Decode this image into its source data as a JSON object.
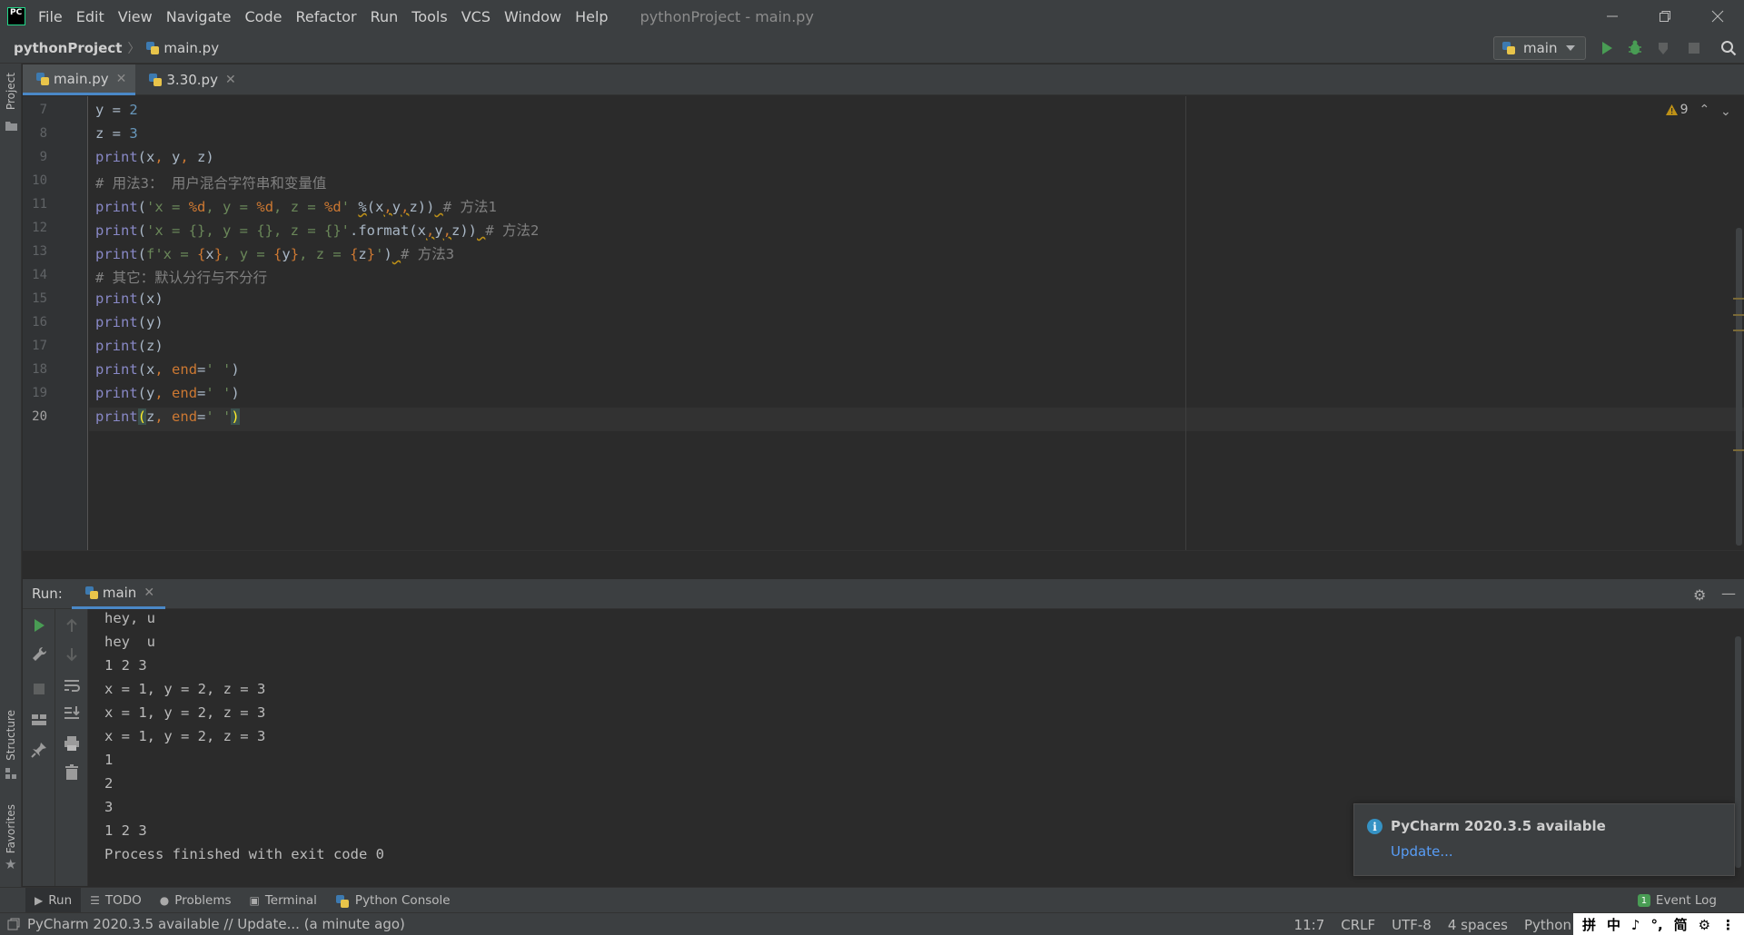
{
  "titlebar": {
    "logo_text": "PC",
    "menu": [
      "File",
      "Edit",
      "View",
      "Navigate",
      "Code",
      "Refactor",
      "Run",
      "Tools",
      "VCS",
      "Window",
      "Help"
    ],
    "title": "pythonProject - main.py"
  },
  "navbar": {
    "project": "pythonProject",
    "file": "main.py",
    "run_config": "main"
  },
  "left_strip": {
    "project": "Project",
    "structure": "Structure",
    "favorites": "Favorites"
  },
  "editor_tabs": [
    {
      "label": "main.py",
      "active": true
    },
    {
      "label": "3.30.py",
      "active": false
    }
  ],
  "editor": {
    "inspection_count": "9",
    "line_numbers": [
      "7",
      "8",
      "9",
      "10",
      "11",
      "12",
      "13",
      "14",
      "15",
      "16",
      "17",
      "18",
      "19",
      "20"
    ],
    "current_line": "20"
  },
  "run_panel": {
    "title": "Run:",
    "tab": "main",
    "output": [
      "hey, u",
      "hey  u",
      "1 2 3",
      "x = 1, y = 2, z = 3",
      "x = 1, y = 2, z = 3",
      "x = 1, y = 2, z = 3",
      "1",
      "2",
      "3",
      "1 2 3",
      "Process finished with exit code 0"
    ]
  },
  "notification": {
    "title": "PyCharm 2020.3.5 available",
    "link": "Update..."
  },
  "tool_windows": [
    "Run",
    "TODO",
    "Problems",
    "Terminal",
    "Python Console"
  ],
  "event_log": {
    "badge": "1",
    "label": "Event Log"
  },
  "status_bar": {
    "message": "PyCharm 2020.3.5 available // Update... (a minute ago)",
    "position": "11:7",
    "line_sep": "CRLF",
    "encoding": "UTF-8",
    "indent": "4 spaces",
    "interpreter": "Python"
  },
  "ime": [
    "拼",
    "中",
    "♪",
    "°,",
    "简",
    "⚙",
    "⋮"
  ],
  "colors": {
    "background": "#2b2b2b",
    "panel": "#3c3f41",
    "accent": "#4a88c7",
    "run_green": "#499c54",
    "link": "#589df6"
  }
}
